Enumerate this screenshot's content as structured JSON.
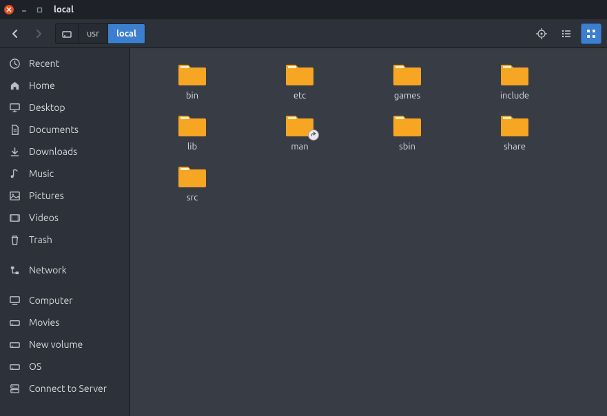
{
  "window": {
    "title": "local"
  },
  "path": {
    "segments": [
      "usr",
      "local"
    ],
    "active_index": 1
  },
  "sidebar": {
    "groups": [
      [
        {
          "id": "recent",
          "label": "Recent",
          "icon": "clock-icon"
        },
        {
          "id": "home",
          "label": "Home",
          "icon": "home-icon"
        },
        {
          "id": "desktop",
          "label": "Desktop",
          "icon": "monitor-icon"
        },
        {
          "id": "documents",
          "label": "Documents",
          "icon": "document-icon"
        },
        {
          "id": "downloads",
          "label": "Downloads",
          "icon": "download-icon"
        },
        {
          "id": "music",
          "label": "Music",
          "icon": "music-icon"
        },
        {
          "id": "pictures",
          "label": "Pictures",
          "icon": "picture-icon"
        },
        {
          "id": "videos",
          "label": "Videos",
          "icon": "video-icon"
        },
        {
          "id": "trash",
          "label": "Trash",
          "icon": "trash-icon"
        }
      ],
      [
        {
          "id": "network",
          "label": "Network",
          "icon": "network-icon"
        }
      ],
      [
        {
          "id": "computer",
          "label": "Computer",
          "icon": "computer-icon"
        },
        {
          "id": "movies",
          "label": "Movies",
          "icon": "drive-icon"
        },
        {
          "id": "newvol",
          "label": "New volume",
          "icon": "drive-icon"
        },
        {
          "id": "os",
          "label": "OS",
          "icon": "drive-icon"
        },
        {
          "id": "connect",
          "label": "Connect to Server",
          "icon": "server-icon"
        }
      ]
    ]
  },
  "toolbar": {
    "view_mode": "icons",
    "items": [
      {
        "id": "location",
        "name": "location-icon"
      },
      {
        "id": "list",
        "name": "list-view-icon"
      },
      {
        "id": "icons",
        "name": "icon-view-icon"
      }
    ]
  },
  "folders": [
    {
      "name": "bin",
      "link": false
    },
    {
      "name": "etc",
      "link": false
    },
    {
      "name": "games",
      "link": false
    },
    {
      "name": "include",
      "link": false
    },
    {
      "name": "lib",
      "link": false
    },
    {
      "name": "man",
      "link": true
    },
    {
      "name": "sbin",
      "link": false
    },
    {
      "name": "share",
      "link": false
    },
    {
      "name": "src",
      "link": false
    }
  ]
}
